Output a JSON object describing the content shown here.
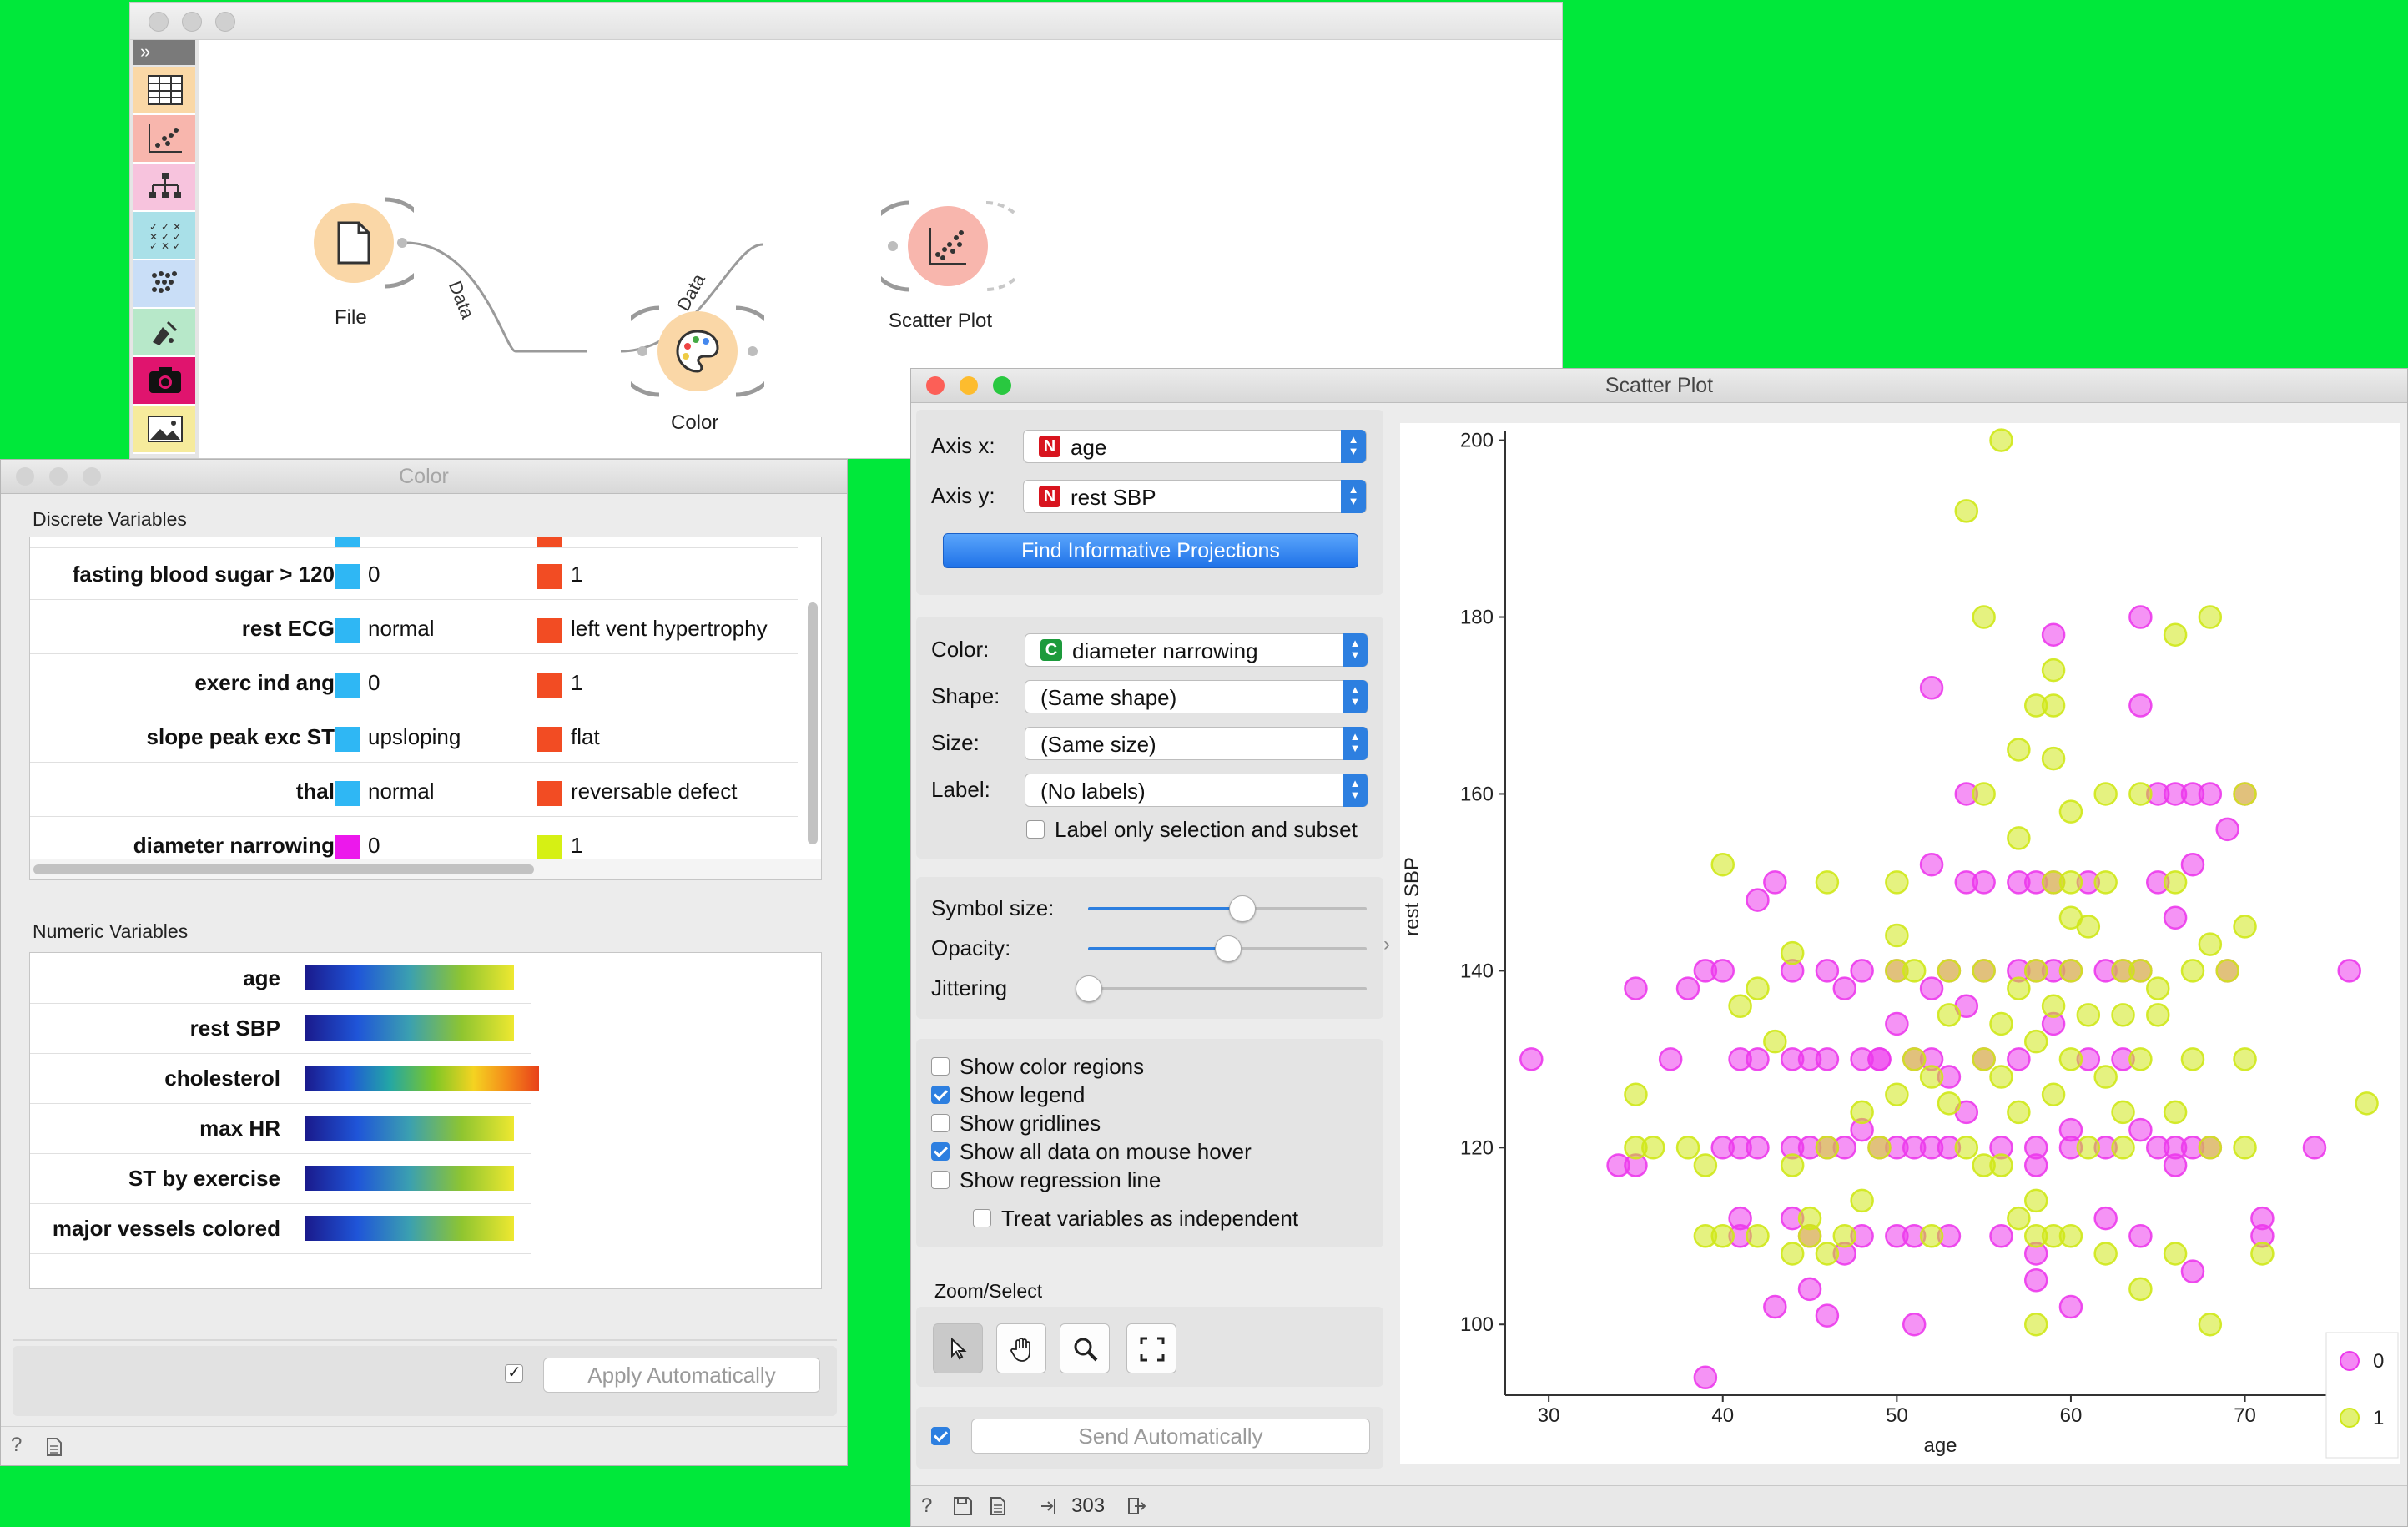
{
  "canvas": {
    "nodes": [
      {
        "id": "file",
        "label": "File"
      },
      {
        "id": "color",
        "label": "Color"
      },
      {
        "id": "scatter",
        "label": "Scatter Plot"
      }
    ],
    "links": [
      {
        "label": "Data"
      },
      {
        "label": "Data"
      }
    ],
    "toolbox": [
      "data-table-icon",
      "scatter-plot-icon",
      "tree-icon",
      "model-grid-icon",
      "clustering-icon",
      "paint-icon",
      "camera-icon",
      "image-icon"
    ]
  },
  "color_window": {
    "title": "Color",
    "discrete_label": "Discrete Variables",
    "numeric_label": "Numeric Variables",
    "discrete": [
      {
        "name": "fasting blood sugar > 120",
        "c0": "#2fb7f4",
        "v0": "0",
        "c1": "#f24c23",
        "v1": "1"
      },
      {
        "name": "rest ECG",
        "c0": "#2fb7f4",
        "v0": "normal",
        "c1": "#f24c23",
        "v1": "left vent hypertrophy"
      },
      {
        "name": "exerc ind ang",
        "c0": "#2fb7f4",
        "v0": "0",
        "c1": "#f24c23",
        "v1": "1"
      },
      {
        "name": "slope peak exc ST",
        "c0": "#2fb7f4",
        "v0": "upsloping",
        "c1": "#f24c23",
        "v1": "flat"
      },
      {
        "name": "thal",
        "c0": "#2fb7f4",
        "v0": "normal",
        "c1": "#f24c23",
        "v1": "reversable defect"
      },
      {
        "name": "diameter narrowing",
        "c0": "#ec18ec",
        "v0": "0",
        "c1": "#d6f014",
        "v1": "1"
      }
    ],
    "numeric": [
      {
        "name": "age",
        "palette": "blue-green-yellow"
      },
      {
        "name": "rest SBP",
        "palette": "blue-green-yellow"
      },
      {
        "name": "cholesterol",
        "palette": "rainbow"
      },
      {
        "name": "max HR",
        "palette": "blue-green-yellow"
      },
      {
        "name": "ST by exercise",
        "palette": "blue-green-yellow"
      },
      {
        "name": "major vessels colored",
        "palette": "blue-green-yellow"
      }
    ],
    "apply_label": "Apply Automatically"
  },
  "scatter_window": {
    "title": "Scatter Plot",
    "axis_x_label": "Axis x:",
    "axis_x_value": "age",
    "axis_y_label": "Axis y:",
    "axis_y_value": "rest SBP",
    "numeric_tag": "N",
    "categorical_tag": "C",
    "find_button": "Find Informative Projections",
    "color_label": "Color:",
    "color_value": "diameter narrowing",
    "shape_label": "Shape:",
    "shape_value": "(Same shape)",
    "size_label": "Size:",
    "size_value": "(Same size)",
    "label_label": "Label:",
    "label_value": "(No labels)",
    "label_only_selection": "Label only selection and subset",
    "symbol_size_label": "Symbol size:",
    "opacity_label": "Opacity:",
    "jittering_label": "Jittering",
    "symbol_size_level": 0.55,
    "opacity_level": 0.5,
    "jittering_level": 0.0,
    "checks": [
      {
        "label": "Show color regions",
        "checked": false
      },
      {
        "label": "Show legend",
        "checked": true
      },
      {
        "label": "Show gridlines",
        "checked": false
      },
      {
        "label": "Show all data on mouse hover",
        "checked": true
      },
      {
        "label": "Show regression line",
        "checked": false
      }
    ],
    "treat_independent": "Treat variables as independent",
    "zoom_label": "Zoom/Select",
    "send_label": "Send Automatically",
    "status_count": "303"
  },
  "chart_data": {
    "type": "scatter",
    "xlabel": "age",
    "ylabel": "rest SBP",
    "xlim": [
      27.5,
      77.5
    ],
    "ylim": [
      92,
      201
    ],
    "xticks": [
      30,
      40,
      50,
      60,
      70
    ],
    "yticks": [
      100,
      120,
      140,
      160,
      180,
      200
    ],
    "grid": false,
    "legend_position": "bottom-right",
    "colors": {
      "0": "#ec3aec",
      "1": "#cfe818"
    },
    "series": [
      {
        "name": "0",
        "points": [
          [
            29,
            130
          ],
          [
            35,
            138
          ],
          [
            35,
            118
          ],
          [
            37,
            130
          ],
          [
            38,
            138
          ],
          [
            39,
            140
          ],
          [
            39,
            94
          ],
          [
            40,
            140
          ],
          [
            40,
            120
          ],
          [
            41,
            130
          ],
          [
            41,
            120
          ],
          [
            41,
            110
          ],
          [
            42,
            130
          ],
          [
            42,
            120
          ],
          [
            42,
            148
          ],
          [
            43,
            150
          ],
          [
            44,
            130
          ],
          [
            44,
            120
          ],
          [
            44,
            140
          ],
          [
            45,
            130
          ],
          [
            45,
            120
          ],
          [
            45,
            104
          ],
          [
            45,
            110
          ],
          [
            46,
            130
          ],
          [
            46,
            120
          ],
          [
            46,
            140
          ],
          [
            47,
            138
          ],
          [
            47,
            120
          ],
          [
            47,
            108
          ],
          [
            48,
            130
          ],
          [
            48,
            122
          ],
          [
            48,
            110
          ],
          [
            49,
            130
          ],
          [
            49,
            120
          ],
          [
            49,
            130
          ],
          [
            50,
            140
          ],
          [
            50,
            120
          ],
          [
            50,
            134
          ],
          [
            51,
            130
          ],
          [
            51,
            120
          ],
          [
            51,
            110
          ],
          [
            51,
            100
          ],
          [
            52,
            130
          ],
          [
            52,
            120
          ],
          [
            52,
            172
          ],
          [
            52,
            152
          ],
          [
            52,
            138
          ],
          [
            53,
            140
          ],
          [
            53,
            120
          ],
          [
            53,
            128
          ],
          [
            54,
            160
          ],
          [
            54,
            150
          ],
          [
            54,
            136
          ],
          [
            54,
            124
          ],
          [
            55,
            140
          ],
          [
            55,
            130
          ],
          [
            56,
            120
          ],
          [
            56,
            110
          ],
          [
            57,
            140
          ],
          [
            57,
            150
          ],
          [
            57,
            130
          ],
          [
            58,
            150
          ],
          [
            58,
            140
          ],
          [
            58,
            120
          ],
          [
            58,
            118
          ],
          [
            58,
            105
          ],
          [
            59,
            150
          ],
          [
            59,
            140
          ],
          [
            59,
            134
          ],
          [
            59,
            178
          ],
          [
            60,
            140
          ],
          [
            60,
            120
          ],
          [
            60,
            102
          ],
          [
            61,
            130
          ],
          [
            61,
            150
          ],
          [
            62,
            140
          ],
          [
            62,
            120
          ],
          [
            63,
            140
          ],
          [
            63,
            130
          ],
          [
            64,
            140
          ],
          [
            64,
            180
          ],
          [
            64,
            170
          ],
          [
            64,
            110
          ],
          [
            65,
            160
          ],
          [
            65,
            150
          ],
          [
            65,
            120
          ],
          [
            66,
            160
          ],
          [
            66,
            146
          ],
          [
            66,
            120
          ],
          [
            67,
            160
          ],
          [
            67,
            152
          ],
          [
            67,
            106
          ],
          [
            67,
            120
          ],
          [
            68,
            120
          ],
          [
            68,
            160
          ],
          [
            69,
            156
          ],
          [
            69,
            140
          ],
          [
            70,
            160
          ],
          [
            71,
            112
          ],
          [
            71,
            110
          ],
          [
            74,
            120
          ],
          [
            76,
            140
          ],
          [
            34,
            118
          ],
          [
            41,
            112
          ],
          [
            43,
            102
          ],
          [
            44,
            112
          ],
          [
            46,
            101
          ],
          [
            48,
            140
          ],
          [
            50,
            110
          ],
          [
            53,
            110
          ],
          [
            55,
            150
          ],
          [
            58,
            108
          ],
          [
            60,
            122
          ],
          [
            62,
            112
          ],
          [
            64,
            122
          ],
          [
            66,
            118
          ]
        ]
      },
      {
        "name": "1",
        "points": [
          [
            35,
            126
          ],
          [
            35,
            120
          ],
          [
            38,
            120
          ],
          [
            39,
            118
          ],
          [
            40,
            110
          ],
          [
            40,
            152
          ],
          [
            41,
            136
          ],
          [
            42,
            110
          ],
          [
            43,
            132
          ],
          [
            44,
            118
          ],
          [
            44,
            142
          ],
          [
            45,
            112
          ],
          [
            45,
            110
          ],
          [
            46,
            150
          ],
          [
            46,
            120
          ],
          [
            47,
            110
          ],
          [
            48,
            124
          ],
          [
            49,
            120
          ],
          [
            50,
            150
          ],
          [
            50,
            144
          ],
          [
            50,
            140
          ],
          [
            51,
            140
          ],
          [
            51,
            130
          ],
          [
            52,
            110
          ],
          [
            52,
            128
          ],
          [
            53,
            140
          ],
          [
            53,
            125
          ],
          [
            54,
            192
          ],
          [
            54,
            120
          ],
          [
            55,
            180
          ],
          [
            55,
            160
          ],
          [
            55,
            130
          ],
          [
            55,
            118
          ],
          [
            56,
            200
          ],
          [
            56,
            134
          ],
          [
            56,
            128
          ],
          [
            57,
            165
          ],
          [
            57,
            155
          ],
          [
            57,
            124
          ],
          [
            57,
            112
          ],
          [
            58,
            170
          ],
          [
            58,
            140
          ],
          [
            58,
            132
          ],
          [
            58,
            114
          ],
          [
            58,
            110
          ],
          [
            59,
            174
          ],
          [
            59,
            170
          ],
          [
            59,
            164
          ],
          [
            59,
            150
          ],
          [
            59,
            136
          ],
          [
            59,
            126
          ],
          [
            59,
            110
          ],
          [
            60,
            158
          ],
          [
            60,
            150
          ],
          [
            60,
            146
          ],
          [
            60,
            140
          ],
          [
            60,
            130
          ],
          [
            61,
            145
          ],
          [
            61,
            135
          ],
          [
            61,
            120
          ],
          [
            62,
            160
          ],
          [
            62,
            150
          ],
          [
            62,
            128
          ],
          [
            63,
            140
          ],
          [
            63,
            135
          ],
          [
            63,
            124
          ],
          [
            63,
            120
          ],
          [
            64,
            160
          ],
          [
            64,
            140
          ],
          [
            64,
            130
          ],
          [
            65,
            135
          ],
          [
            65,
            138
          ],
          [
            66,
            150
          ],
          [
            66,
            178
          ],
          [
            66,
            124
          ],
          [
            67,
            140
          ],
          [
            67,
            130
          ],
          [
            68,
            180
          ],
          [
            68,
            120
          ],
          [
            68,
            143
          ],
          [
            68,
            100
          ],
          [
            69,
            140
          ],
          [
            70,
            145
          ],
          [
            70,
            130
          ],
          [
            70,
            160
          ],
          [
            70,
            120
          ],
          [
            71,
            108
          ],
          [
            77,
            125
          ],
          [
            53,
            135
          ],
          [
            55,
            140
          ],
          [
            56,
            118
          ],
          [
            58,
            100
          ],
          [
            60,
            110
          ],
          [
            62,
            108
          ],
          [
            64,
            104
          ],
          [
            66,
            108
          ],
          [
            57,
            138
          ],
          [
            50,
            126
          ],
          [
            48,
            114
          ],
          [
            46,
            108
          ],
          [
            44,
            108
          ],
          [
            42,
            138
          ],
          [
            36,
            120
          ],
          [
            39,
            110
          ]
        ]
      }
    ]
  }
}
